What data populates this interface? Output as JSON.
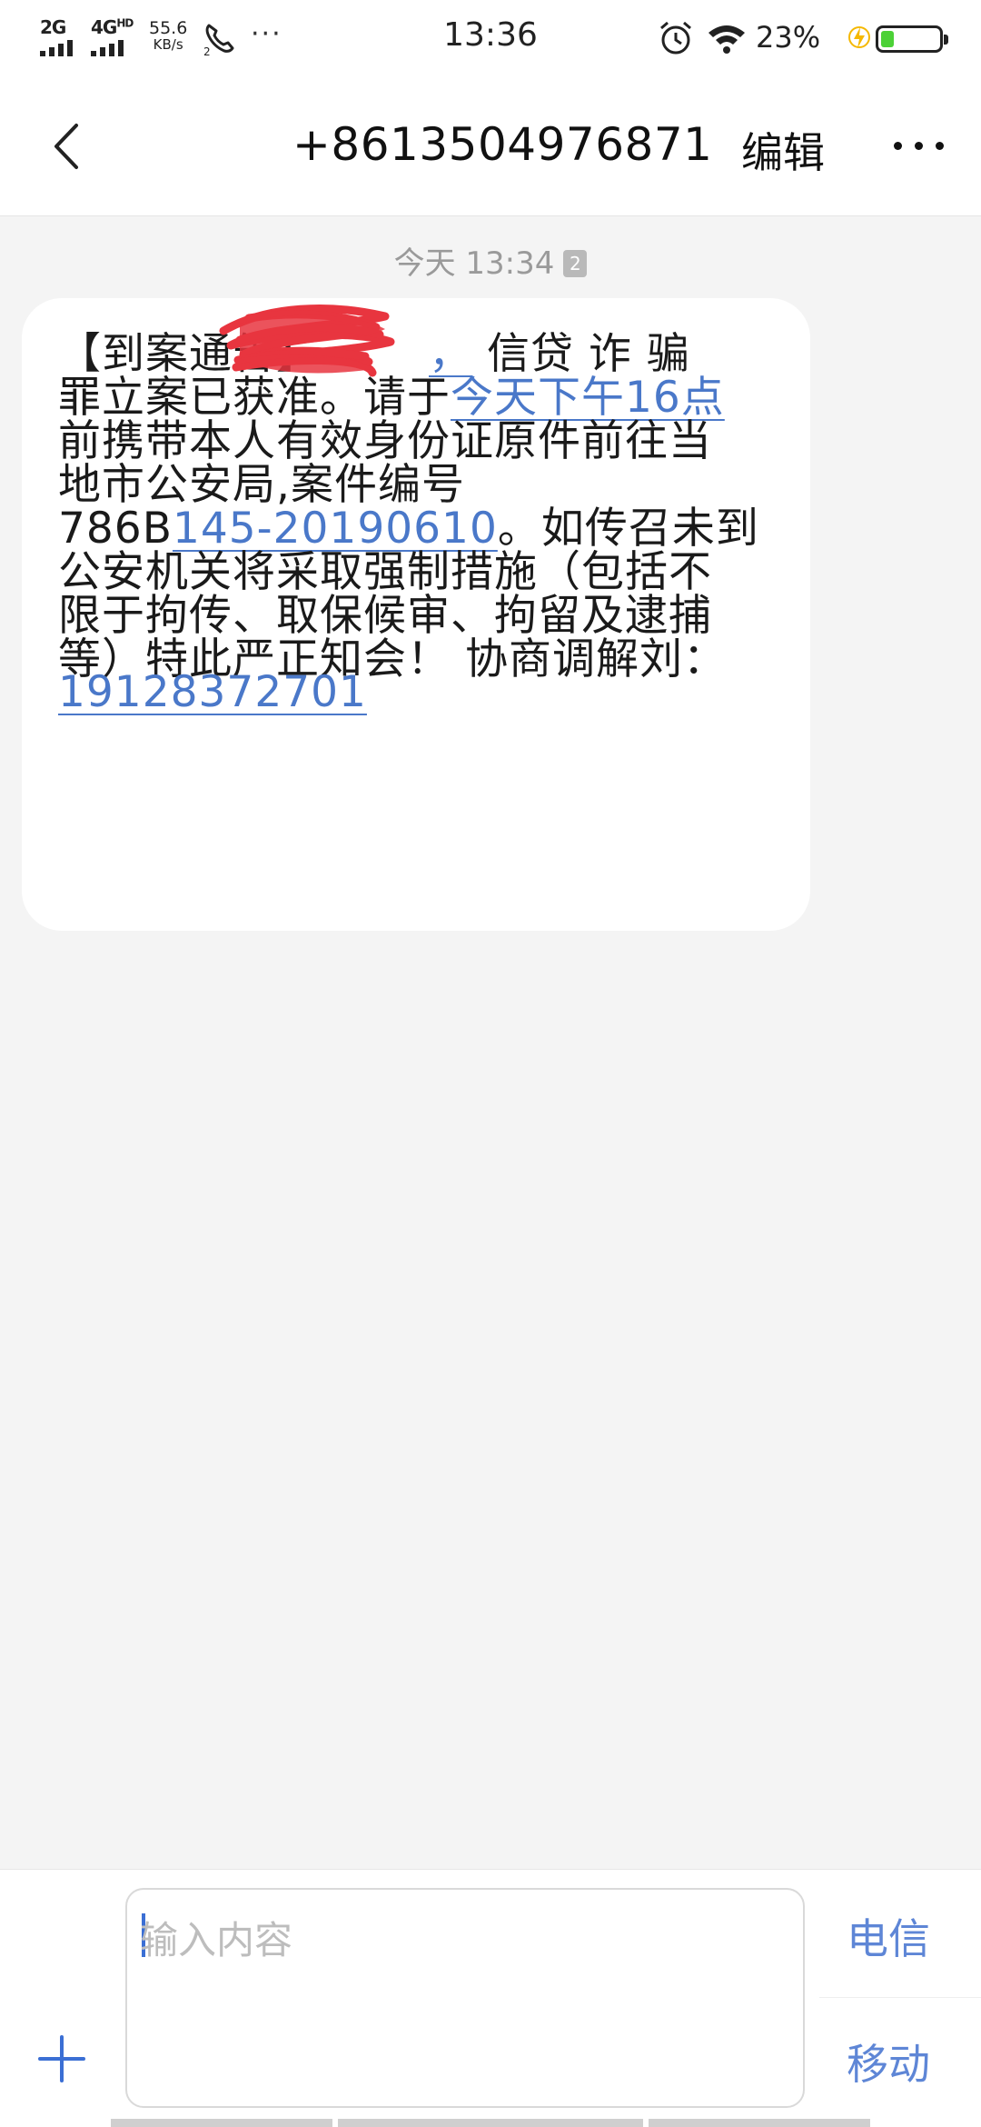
{
  "status_bar": {
    "sim1_gen": "2G",
    "sim2_gen": "4G",
    "sim2_sup": "HD",
    "net_speed_value": "55.6",
    "net_speed_unit": "KB/s",
    "more": "···",
    "time": "13:36",
    "battery_percent": "23%",
    "battery_level": 0.23
  },
  "header": {
    "contact": "+8613504976871",
    "edit_label": "编辑"
  },
  "conversation": {
    "timestamp": "今天 13:34",
    "sim_badge": "2",
    "message": {
      "l1_a": "【到案通告】",
      "l1_link": "，",
      "l1_b": " 信贷 诈 骗",
      "l2_a": "罪立案已获准。请于",
      "l2_link": "今天下午16点",
      "l3": "前携带本人有效身份证原件前往当",
      "l4": "地市公安局,案件编号",
      "l5_a": "786B",
      "l5_link": "145-20190610",
      "l5_b": "。如传召未到",
      "l6": "公安机关将采取强制措施（包括不",
      "l7": "限于拘传、取保候审、拘留及逮捕",
      "l8": "等）特此严正知会！ 协商调解刘：",
      "l9_link": "19128372701"
    }
  },
  "input": {
    "placeholder": "输入内容",
    "send_telecom": "电信",
    "send_mobile": "移动"
  },
  "colors": {
    "link": "#4a78c9",
    "send": "#5e86d6",
    "scribble": "#e8353f",
    "battery_fill": "#4cd137",
    "charge": "#f5b800"
  }
}
